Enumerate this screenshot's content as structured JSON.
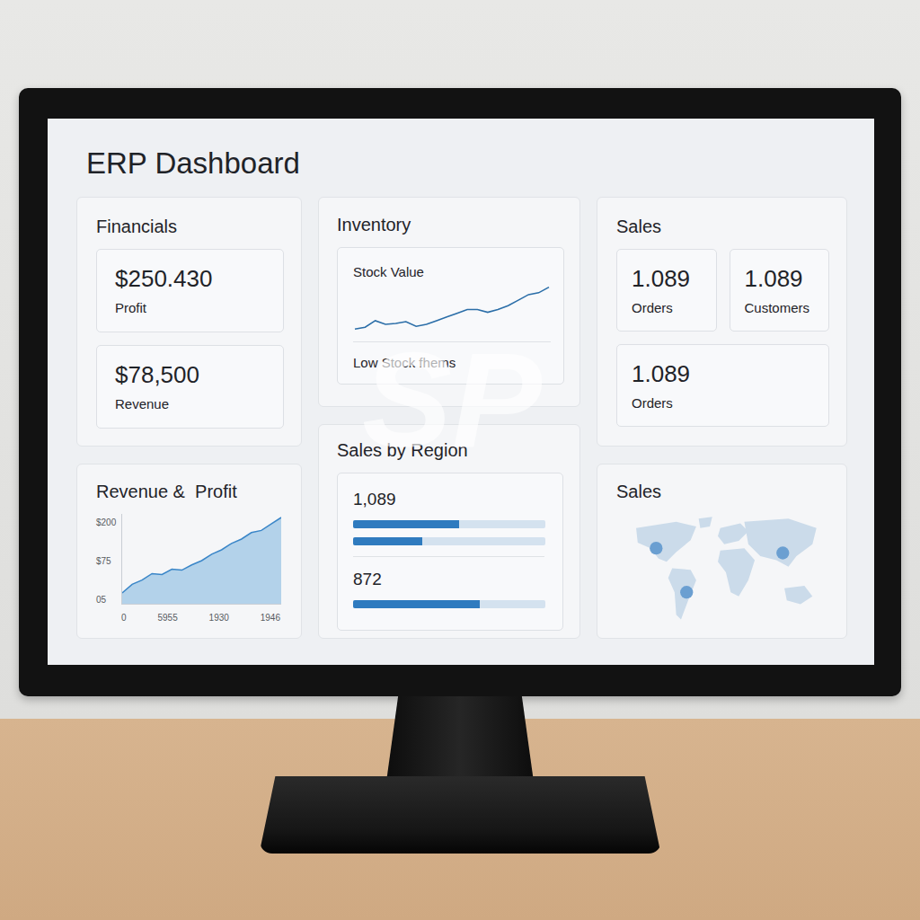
{
  "title": "ERP Dashboard",
  "watermark": "SP",
  "financials": {
    "title": "Financials",
    "metrics": [
      {
        "value": "$250.430",
        "label": "Profit"
      },
      {
        "value": "$78,500",
        "label": "Revenue"
      }
    ]
  },
  "inventory": {
    "title": "Inventory",
    "chart_title": "Stock Value",
    "series": [
      10,
      12,
      19,
      15,
      16,
      18,
      13,
      15,
      19,
      23,
      27,
      31,
      31,
      28,
      31,
      35,
      41,
      47,
      49,
      55
    ],
    "footer": "Low Stock fhems"
  },
  "sales": {
    "title": "Sales",
    "metrics": [
      {
        "value": "1.089",
        "label": "Orders"
      },
      {
        "value": "1.089",
        "label": "Customers"
      },
      {
        "value": "1.089",
        "label": "Orders"
      }
    ]
  },
  "revenue_chart": {
    "title": "Revenue &  Profit",
    "y_ticks": [
      "$200",
      "$75",
      "05"
    ],
    "x_ticks": [
      "0",
      "5955",
      "1930",
      "1946"
    ],
    "series": [
      25,
      45,
      55,
      70,
      68,
      80,
      78,
      90,
      100,
      115,
      125,
      140,
      150,
      165,
      170,
      185,
      200
    ]
  },
  "sales_by_region": {
    "title": "Sales by Region",
    "rows": [
      {
        "label": "1,089",
        "bars": [
          0.55,
          0.36
        ]
      },
      {
        "label": "872",
        "bars": [
          0.66
        ]
      }
    ]
  },
  "sales_map": {
    "title": "Sales"
  }
}
